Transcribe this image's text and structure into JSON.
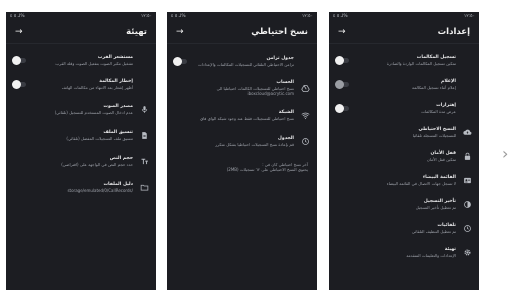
{
  "screen1": {
    "status_left": "‏لـ ٥ ٤%",
    "status_right": "١٢:٥٠",
    "title": "إعدادات",
    "items": [
      {
        "title": "تسجيل المكالمات",
        "subtitle": "تمكين تسجيل المكالمات الواردة والصادرة",
        "control": "toggle-on"
      },
      {
        "title": "الإعلام",
        "subtitle": "إعلام أثناء تسجيل المكالمة",
        "control": "toggle-dim"
      },
      {
        "title": "إهتزازات",
        "subtitle": "عرض مدة المكالمات",
        "control": "toggle-on"
      },
      {
        "title": "النسخ الاحتياطي",
        "subtitle": "للتسجيلات المسجلة تلقائيا",
        "icon": "cloud-upload-icon"
      },
      {
        "title": "قفل الأمان",
        "subtitle": "تمكين قفل الأمان",
        "icon": "lock-icon"
      },
      {
        "title": "القائمة البيضاء",
        "subtitle": "لا تسجل جهات الاتصال في القائمة البيضاء",
        "icon": "contact-card-icon"
      },
      {
        "title": "تأخير التسجيل",
        "subtitle": "تم تعطيل تأخير التسجيل",
        "icon": "timer-icon"
      },
      {
        "title": "تلقائيات",
        "subtitle": "تم تعطيل التنظيف التلقائي",
        "icon": "clock-icon"
      },
      {
        "title": "تهيئة",
        "subtitle": "الإعدادات والتعليمات المتقدمة",
        "icon": "gear-icon"
      }
    ]
  },
  "screen2": {
    "status_left": "‏لـ ٥ ٤%",
    "status_right": "١٢:٥٠",
    "title": "نسخ احتياطي",
    "items": [
      {
        "title": "جدول تزامن",
        "subtitle": "تزامن الاحتياطي التلقائي للتسجيلات المكالمات والإعدادات",
        "control": "toggle-on"
      },
      {
        "title": "الحساب",
        "subtitle": "نسخ احتياطي للتسجيلات الكالمات احتياطيا الى",
        "detail": "iboxcloud@acrytic.com",
        "icon": "drive-icon"
      },
      {
        "title": "الشبكة",
        "subtitle": "نسخ احتياطي للتسجيلات فقط عند وجود شبكة الواي فاي",
        "icon": "wifi-icon"
      },
      {
        "title": "الجدول",
        "subtitle": "قم بإعادة نسخ التسجيلات احتياطيا بشكل متكرر",
        "icon": "clock-icon"
      }
    ],
    "info_line1": "آخر نسخ احتياطي كان في :",
    "info_line2": "يحتوي النسخ الاحتياطي على ٦٢ تسجيلات (2MB)"
  },
  "screen3": {
    "status_left": "‏لـ ٥ ٤%",
    "status_right": "١٢:٥٠",
    "title": "تهيئة",
    "items": [
      {
        "title": "مستشعر القرب",
        "subtitle": "تشغيل مكبر الصوت بتفعيل الصوت وقلة القرب",
        "control": "toggle-on"
      },
      {
        "title": "إخطار المكالمة",
        "subtitle": "أظهر إشعار بعد الانتهاء من مكالمات الهاتف",
        "control": "toggle-on"
      },
      {
        "title": "مصدر الصوت",
        "subtitle": "عدم ادخال الصوت المستخدم للتسجيل (تلقائي)",
        "icon": "microphone-icon"
      },
      {
        "title": "تنسيق الملف",
        "subtitle": "تنسيق ملف التسجيلات المفضل (تلقائي)",
        "icon": "file-icon"
      },
      {
        "title": "حجم النص",
        "subtitle": "حدد حجم النص في الواجهة على (افتراضي)",
        "icon": "text-size-icon"
      },
      {
        "title": "دليل الملفات",
        "subtitle": "/storage/emulated/0/CallRecords",
        "icon": "folder-icon"
      }
    ]
  },
  "nav": {
    "next_icon": "chevron-right-icon",
    "next_glyph": "›"
  }
}
